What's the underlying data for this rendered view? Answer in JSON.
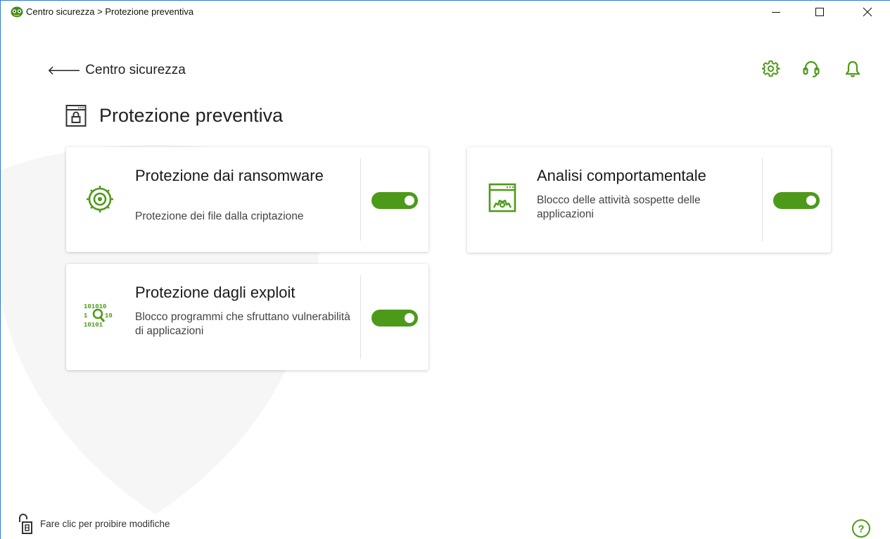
{
  "window": {
    "title": "Centro sicurezza > Protezione preventiva",
    "controls": {
      "minimize": "minimize-icon",
      "maximize": "maximize-icon",
      "close": "close-icon"
    }
  },
  "header": {
    "back_arrow": "🡐",
    "back_label": "Centro sicurezza",
    "icons": [
      "gear-icon",
      "headset-icon",
      "bell-icon"
    ]
  },
  "page": {
    "title": "Protezione preventiva",
    "icon": "browser-lock-icon"
  },
  "cards": [
    {
      "title": "Protezione dai ransomware",
      "description": "Protezione dei file dalla criptazione",
      "icon": "ransomware-shield-icon",
      "enabled": true
    },
    {
      "title": "Analisi comportamentale",
      "description": "Blocco delle attività sospette delle applicazioni",
      "icon": "window-gear-icon",
      "enabled": true
    },
    {
      "title": "Protezione dagli exploit",
      "description": "Blocco programmi che sfruttano vulnerabilità di applicazioni",
      "icon": "binary-magnifier-icon",
      "enabled": true
    }
  ],
  "footer": {
    "lock_text": "Fare clic per proibire modifiche",
    "lock_icon": "unlocked-padlock-icon",
    "help_label": "?"
  },
  "colors": {
    "accent": "#4d9a1a",
    "icon_green": "#4f9a19",
    "titlebar_border": "#2f7bd6"
  }
}
